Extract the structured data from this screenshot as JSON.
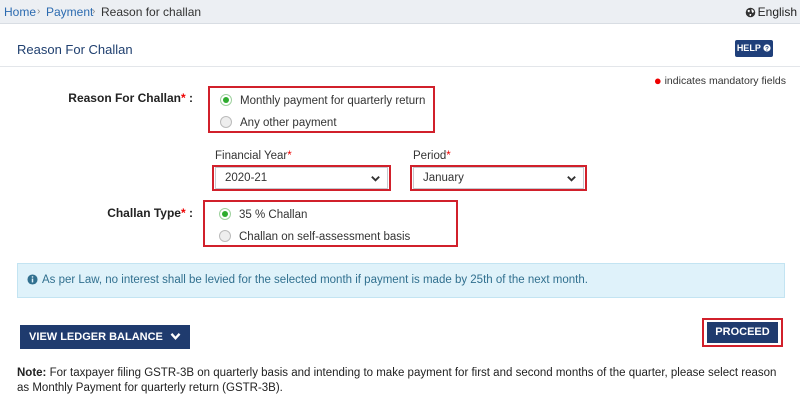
{
  "breadcrumb": {
    "items": [
      "Home",
      "Payment",
      "Reason for challan"
    ],
    "separator": "›"
  },
  "language": {
    "label": "English",
    "icon": "globe-icon"
  },
  "page": {
    "title": "Reason For Challan",
    "help_label": "HELP",
    "help_icon": "help-circle-icon",
    "mandatory_text": "indicates mandatory fields"
  },
  "reason": {
    "label": "Reason For Challan",
    "options": [
      {
        "label": "Monthly payment for quarterly return",
        "selected": true
      },
      {
        "label": "Any other payment",
        "selected": false
      }
    ]
  },
  "financial_year": {
    "label": "Financial Year",
    "value": "2020-21"
  },
  "period": {
    "label": "Period",
    "value": "January"
  },
  "challan_type": {
    "label": "Challan Type",
    "options": [
      {
        "label": "35 % Challan",
        "selected": true
      },
      {
        "label": "Challan on self-assessment basis",
        "selected": false
      }
    ]
  },
  "info": {
    "icon": "info-icon",
    "text": "As per Law, no interest shall be levied for the selected month if payment is made by 25th of the next month."
  },
  "buttons": {
    "ledger": "VIEW LEDGER BALANCE",
    "ledger_icon": "chevron-down-icon",
    "proceed": "PROCEED"
  },
  "note": {
    "label": "Note:",
    "text": "For taxpayer filing GSTR-3B on quarterly basis and intending to make payment for first and second months of the quarter, please select reason as Monthly Payment for quarterly return (GSTR-3B)."
  },
  "colors": {
    "primary": "#1f3b6e",
    "highlight_border": "#d1202b",
    "radio_selected": "#2eac2e",
    "info_bg": "#dff2fa"
  }
}
